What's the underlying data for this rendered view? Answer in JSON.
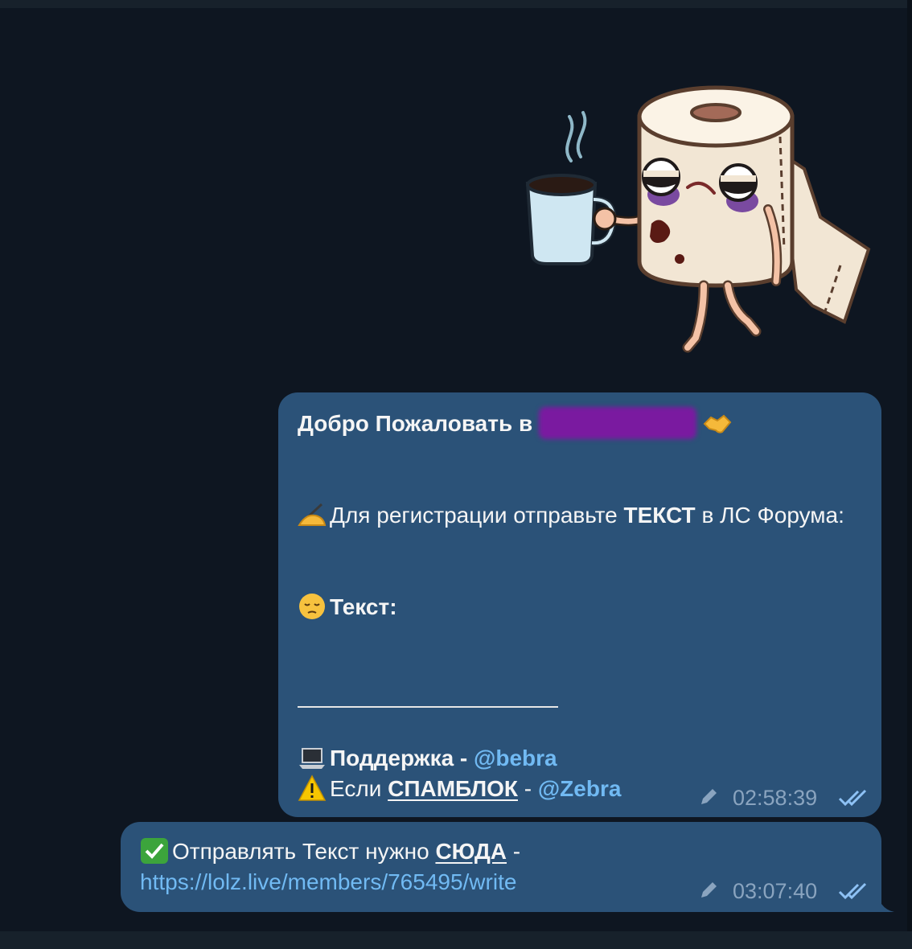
{
  "messages": [
    {
      "greeting_prefix": "Добро Пожаловать в",
      "register_prefix": "Для регистрации отправьте ",
      "register_bold": "ТЕКСТ",
      "register_suffix": " в ЛС Форума:",
      "text_label": "Текст:",
      "support_label": "Поддержка - ",
      "support_handle": "@bebra",
      "spam_prefix": "Если ",
      "spam_word": "СПАМБЛОК",
      "spam_sep": " - ",
      "spam_handle": "@Zebra",
      "time": "02:58:39"
    },
    {
      "send_prefix": "Отправлять Текст нужно ",
      "send_word": "СЮДА",
      "send_suffix": " -",
      "link": "https://lolz.live/members/765495/write",
      "time": "03:07:40"
    }
  ],
  "icons": {
    "sticker": "toilet-paper-coffee-sticker",
    "edited": "pencil-icon",
    "read": "double-check-icon"
  },
  "colors": {
    "background": "#0e1621",
    "bubble": "#2b5278",
    "link": "#71baf3",
    "meta": "#8aa4bf"
  }
}
